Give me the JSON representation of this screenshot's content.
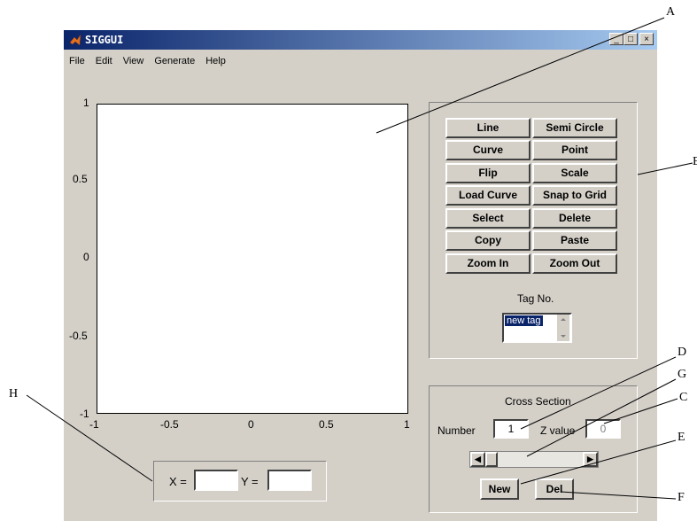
{
  "window": {
    "title": "SIGGUI",
    "minimize": "_",
    "maximize": "□",
    "close": "×"
  },
  "menu": [
    "File",
    "Edit",
    "View",
    "Generate",
    "Help"
  ],
  "plot": {
    "y_ticks": [
      "1",
      "0.5",
      "0",
      "-0.5",
      "-1"
    ],
    "x_ticks": [
      "-1",
      "-0.5",
      "0",
      "0.5",
      "1"
    ]
  },
  "tools": {
    "buttons": [
      "Line",
      "Semi Circle",
      "Curve",
      "Point",
      "Flip",
      "Scale",
      "Load Curve",
      "Snap to Grid",
      "Select",
      "Delete",
      "Copy",
      "Paste",
      "Zoom In",
      "Zoom Out"
    ],
    "tag_label": "Tag No.",
    "tag_selected": "new tag"
  },
  "cross_section": {
    "title": "Cross Section",
    "number_label": "Number",
    "number_value": "1",
    "z_label": "Z value",
    "z_value": "0",
    "slider_left": "◀",
    "slider_right": "▶",
    "new_label": "New",
    "del_label": "Del"
  },
  "coords": {
    "x_label": "X =",
    "y_label": "Y ="
  },
  "callouts": {
    "A": "A",
    "B": "B",
    "C": "C",
    "D": "D",
    "E": "E",
    "F": "F",
    "G": "G",
    "H": "H"
  }
}
